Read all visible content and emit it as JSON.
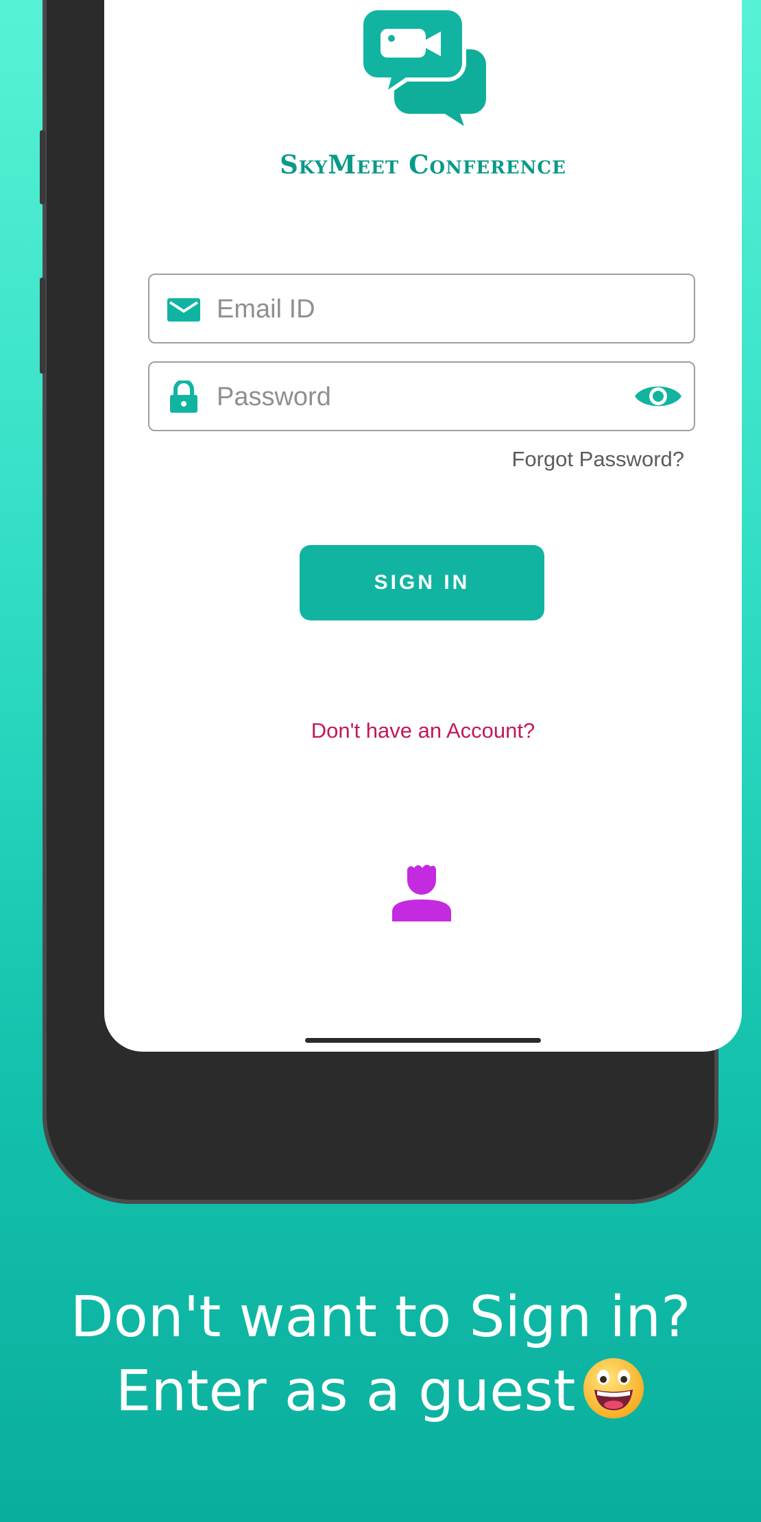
{
  "app": {
    "title": "SkyMeet Conference",
    "logo_icon": "video-chat-bubbles-icon"
  },
  "login": {
    "email": {
      "placeholder": "Email ID",
      "value": "",
      "icon": "mail-icon"
    },
    "password": {
      "placeholder": "Password",
      "value": "",
      "icon": "lock-icon",
      "toggle_icon": "eye-icon"
    },
    "forgot_label": "Forgot Password?",
    "signin_label": "SIGN IN",
    "no_account_label": "Don't have an Account?",
    "guest_icon": "person-icon"
  },
  "promo": {
    "line1": "Don't want to Sign in?",
    "line2": "Enter as a guest",
    "emoji": "grinning-face-emoji"
  },
  "colors": {
    "accent": "#11b4a1",
    "link": "#c2185b",
    "guest_icon": "#c42ae0"
  }
}
